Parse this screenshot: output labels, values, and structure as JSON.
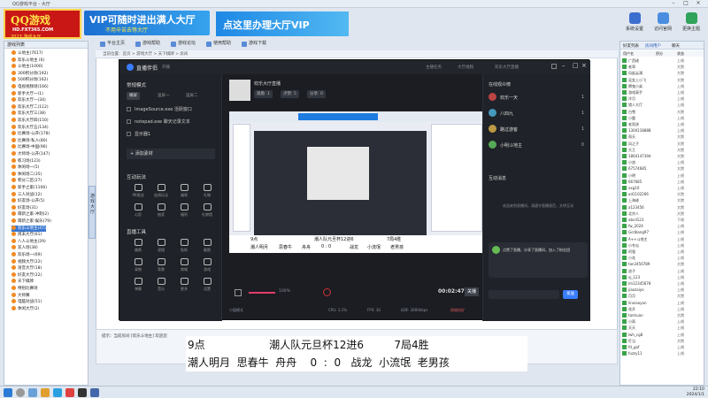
{
  "titlebar": {
    "title": "QQ游戏平台 - 大厅"
  },
  "logo": {
    "line1": "QQ游戏",
    "line2": "HD.FXT365.COM",
    "line3": "2023 游戏大厅"
  },
  "banner_left": {
    "headline": "VIP可随时进出满人大厅",
    "sub": "不用辛苦去等大厅"
  },
  "banner_right": {
    "headline": "点这里办理大厅VIP"
  },
  "top_buttons": [
    {
      "label": "系统设置",
      "color": "#3b6fcf"
    },
    {
      "label": "访问官网",
      "color": "#4a8de0"
    },
    {
      "label": "更换主题",
      "color": "#2fa35a"
    }
  ],
  "nav_tabs": [
    "平台主页",
    "游戏帮助",
    "游戏论坛",
    "使用帮助",
    "游戏下载"
  ],
  "address": "当前位置：首页 > 游戏大厅 > 天下棋牌 > 房间",
  "left_tree": {
    "header": "游戏列表",
    "items": [
      "斗地主(7617)",
      "欢乐斗地主 (6)",
      "斗地主(1000)",
      "300积分场(192)",
      "500积分场(162)",
      "电视视频场(166)",
      "新手大厅一(1)",
      "欢乐大厅一(34)",
      "欢乐大厅二(112)",
      "欢乐大厅三(38)",
      "欢乐大厅四(150)",
      "欢乐大厅五(134)",
      "比赛场-公开(178)",
      "比赛场-私人(80)",
      "比赛场-中国(96)",
      "大师场-公开(147)",
      "练习场(123)",
      "休闲场一(5)",
      "休闲场二(35)",
      "积分二区(27)",
      "新手之家(1106)",
      "三人对战(12)",
      "好友场-公开(5)",
      "好友场(31)",
      "萌新之家-冲刺(2)",
      "萌新之家-娱乐(79)",
      "欢乐斗地主(47)",
      "周末大厅(61)",
      "八人斗地主(29)",
      "双人场(38)",
      "欢乐场一(69)",
      "视频大厅(22)",
      "语音大厅(18)",
      "好友大厅(22)",
      "天下棋牌",
      "特别比赛场",
      "大师赛",
      "电脑对战(51)",
      "休闲大厅(2)"
    ],
    "selected_index": 26
  },
  "vertical_tab": "游戏大厅",
  "obs": {
    "app": "直播伴侣",
    "app_sub": "开播",
    "header_right": [
      "主播任务",
      "大厅视频",
      "设置"
    ],
    "scene_title": "常规模式",
    "scene_tabs": [
      "横屏",
      "竖屏一",
      "竖屏二"
    ],
    "sources": [
      "ImageSource.exe 活跃窗口",
      "notepad.exe 聊天记录文本",
      "显示器1"
    ],
    "add_source": "添加素材",
    "interactive_title": "互动玩法",
    "interactive": [
      "PK挑战",
      "连线玩法",
      "福袋",
      "礼物",
      "心愿",
      "抽奖",
      "福利",
      "礼物墙"
    ],
    "tools_title": "直播工具",
    "tools": [
      "美颜",
      "滤镜",
      "贴纸",
      "截图",
      "录制",
      "背景",
      "商城",
      "游戏"
    ],
    "extra_tools": [
      "弹幕",
      "音乐",
      "更多",
      "设置"
    ],
    "room_title": "欢乐大厅直播",
    "room_meta": [
      "观看: 1",
      "点赞: 5",
      "分享: 0"
    ],
    "rank_title": "在线观众榜",
    "viewers": [
      {
        "name": "欢乐一天",
        "score": "1"
      },
      {
        "name": "八四九",
        "score": "1"
      },
      {
        "name": "路过游客",
        "score": "1"
      },
      {
        "name": "小明斗地主",
        "score": "0"
      }
    ],
    "chat_title": "互动消息",
    "chat_notice": "欢迎来到直播间，请遵守直播规范，文明互动",
    "chat_msg": "点赞了直播，分享了直播间，加入了粉丝团",
    "chat_send": "发送",
    "timer": "00:02:47",
    "stop": "关播",
    "volume": "100%",
    "status_left": "小窗模式",
    "status_cpu": "CPU: 3.2%",
    "status_fps": "FPS: 30",
    "status_bitrate": "码率: 2800kbps",
    "status_right": "网络良好"
  },
  "preview": {
    "foot_row1": [
      "9点",
      "潮人队元旦杯12进6",
      "7局4胜"
    ],
    "foot_row2": [
      "潮人明月",
      "思春牛",
      "舟舟",
      "0 : 0",
      "战龙",
      "小流氓",
      "老男孩"
    ]
  },
  "right_panel": {
    "tabs": [
      "好友列表",
      "房间用户",
      "聊天"
    ],
    "columns": [
      "用户名",
      "积分",
      "状态"
    ],
    "rows": [
      {
        "name": "广西佬",
        "status": "上线"
      },
      {
        "name": "老哥",
        "status": "大院"
      },
      {
        "name": "风起云涌",
        "status": "大院"
      },
      {
        "name": "吴女上小飞",
        "status": "大院"
      },
      {
        "name": "牌鬼小弟",
        "status": "上线"
      },
      {
        "name": "游戏高手",
        "status": "上线"
      },
      {
        "name": "冷月",
        "status": "上线"
      },
      {
        "name": "猎人大厅",
        "status": "上线"
      },
      {
        "name": "白雪",
        "status": "大院"
      },
      {
        "name": "小鹿",
        "status": "上线"
      },
      {
        "name": "老男孩",
        "status": "上线"
      },
      {
        "name": "1304118888",
        "status": "上线"
      },
      {
        "name": "雨天",
        "status": "大院"
      },
      {
        "name": "风之子",
        "status": "大院"
      },
      {
        "name": "大王",
        "status": "大院"
      },
      {
        "name": "1864147394",
        "status": "大院"
      },
      {
        "name": "小浪",
        "status": "上线"
      },
      {
        "name": "67574685",
        "status": "大院"
      },
      {
        "name": "小明",
        "status": "上线"
      },
      {
        "name": "667685",
        "status": "上线"
      },
      {
        "name": "xxg10",
        "status": "上线"
      },
      {
        "name": "ad1102266",
        "status": "大院"
      },
      {
        "name": "上海佬",
        "status": "大院"
      },
      {
        "name": "a123456",
        "status": "大院"
      },
      {
        "name": "北京人",
        "status": "大院"
      },
      {
        "name": "abcd123",
        "status": "下线"
      },
      {
        "name": "fw_2024",
        "status": "上线"
      },
      {
        "name": "Gcdbang97",
        "status": "上线"
      },
      {
        "name": "A++斗地主",
        "status": "上线"
      },
      {
        "name": "小冬瓜",
        "status": "上线"
      },
      {
        "name": "阿强",
        "status": "上线"
      },
      {
        "name": "小花",
        "status": "上线"
      },
      {
        "name": "tan3456789",
        "status": "大院"
      },
      {
        "name": "浪子",
        "status": "上线"
      },
      {
        "name": "xj_123",
        "status": "上线"
      },
      {
        "name": "lm12345678",
        "status": "上线"
      },
      {
        "name": "jiaozaiyo",
        "status": "上线"
      },
      {
        "name": "月月",
        "status": "大院"
      },
      {
        "name": "linxiaoyan",
        "status": "上线"
      },
      {
        "name": "花开",
        "status": "上线"
      },
      {
        "name": "tanhuan",
        "status": "大院"
      },
      {
        "name": "小雨",
        "status": "上线"
      },
      {
        "name": "天天",
        "status": "上线"
      },
      {
        "name": "lwh_cg8",
        "status": "上线"
      },
      {
        "name": "叮当",
        "status": "大院"
      },
      {
        "name": "fd_gaf",
        "status": "上线"
      },
      {
        "name": "fuzzy11",
        "status": "上线"
      }
    ]
  },
  "bottom_info": {
    "hint": "提示：当前房间 [欢乐斗地主] 欢迎您"
  },
  "overlay": {
    "row1": "9点                   潮人队元旦杯12进6         7局4胜",
    "row2": "潮人明月  思春牛  舟舟    0  :  0   战龙  小流氓  老男孩"
  },
  "taskbar": {
    "time": "22:10",
    "date": "2024/1/1"
  }
}
